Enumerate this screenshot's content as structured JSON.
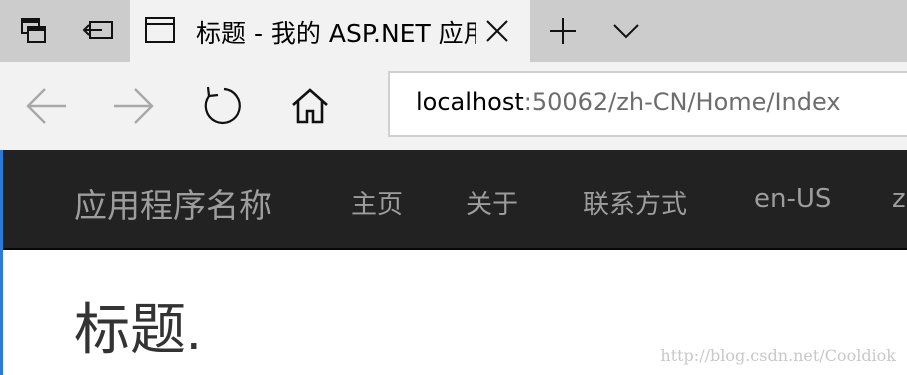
{
  "tab": {
    "title": "标题 - 我的 ASP.NET 应用程序"
  },
  "address": {
    "host": "localhost",
    "rest": ":50062/zh-CN/Home/Index"
  },
  "site": {
    "brand": "应用程序名称",
    "links": [
      "主页",
      "关于",
      "联系方式",
      "en-US",
      "zh-CN"
    ]
  },
  "content": {
    "heading": "标题."
  },
  "watermark": "http://blog.csdn.net/Cooldiok",
  "colors": {
    "tabstrip": "#cccccc",
    "chrome": "#f2f2f2",
    "site_navbar": "#222222",
    "site_link": "#9d9d9d",
    "heading": "#333333",
    "accent": "#2b7bd6"
  },
  "icons": [
    "tab-manager-icon",
    "set-tabs-aside-icon",
    "page-icon",
    "close-icon",
    "new-tab-icon",
    "chevron-down-icon",
    "back-icon",
    "forward-icon",
    "refresh-icon",
    "home-icon"
  ]
}
